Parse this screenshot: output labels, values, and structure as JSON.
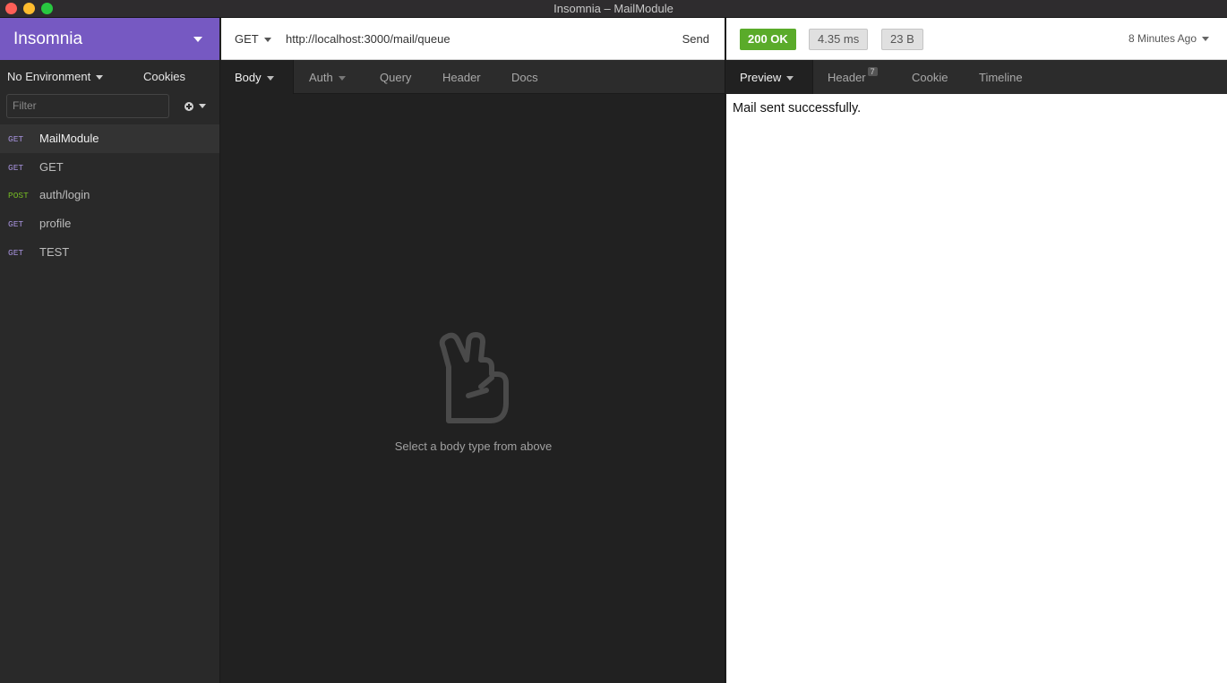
{
  "window": {
    "title": "Insomnia – MailModule"
  },
  "sidebar": {
    "workspace": "Insomnia",
    "environment": "No Environment",
    "cookies": "Cookies",
    "filter_placeholder": "Filter",
    "requests": [
      {
        "method": "GET",
        "name": "MailModule",
        "active": true
      },
      {
        "method": "GET",
        "name": "GET",
        "active": false
      },
      {
        "method": "POST",
        "name": "auth/login",
        "active": false
      },
      {
        "method": "GET",
        "name": "profile",
        "active": false
      },
      {
        "method": "GET",
        "name": "TEST",
        "active": false
      }
    ]
  },
  "request": {
    "method": "GET",
    "url": "http://localhost:3000/mail/queue",
    "send_label": "Send",
    "tabs": {
      "body": "Body",
      "auth": "Auth",
      "query": "Query",
      "header": "Header",
      "docs": "Docs"
    },
    "empty_message": "Select a body type from above"
  },
  "response": {
    "status": "200 OK",
    "time": "4.35 ms",
    "size": "23 B",
    "time_ago": "8 Minutes Ago",
    "tabs": {
      "preview": "Preview",
      "header": "Header",
      "header_count": "7",
      "cookie": "Cookie",
      "timeline": "Timeline"
    },
    "body": "Mail sent successfully."
  },
  "colors": {
    "accent": "#7659c2",
    "status_ok": "#5aab2a",
    "method_get": "#a692dc",
    "method_post": "#75ba24"
  }
}
